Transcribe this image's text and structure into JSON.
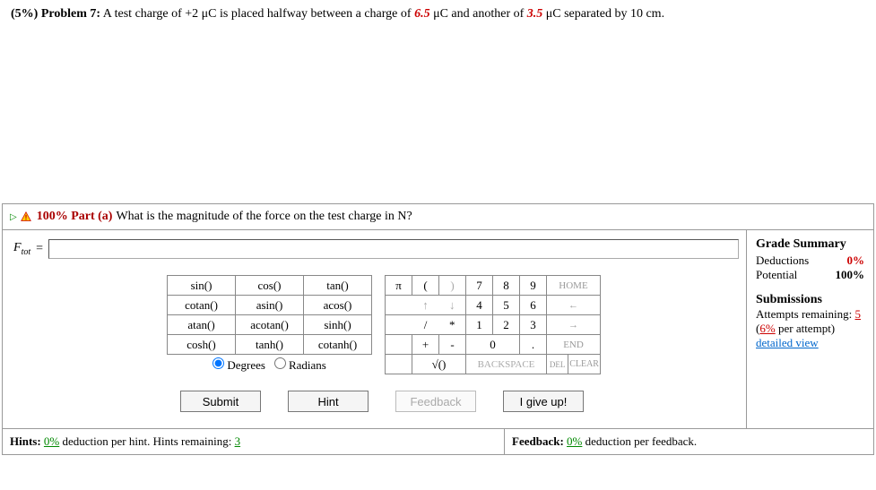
{
  "problem": {
    "label_prefix": "(5%) Problem 7:",
    "text_before_g1": " A test charge of +2 μC is placed halfway between a charge of ",
    "given1": "6.5",
    "text_mid": " μC and another of ",
    "given2": "3.5",
    "text_after": " μC separated by 10 cm."
  },
  "part": {
    "percent_label": "100% Part (a)",
    "question": "  What is the magnitude of the force on the test charge in N?"
  },
  "answer": {
    "var": "F",
    "sub": "tot",
    "equals": " = ",
    "value": ""
  },
  "funcs": {
    "r1": [
      "sin()",
      "cos()",
      "tan()"
    ],
    "r2": [
      "cotan()",
      "asin()",
      "acos()"
    ],
    "r3": [
      "atan()",
      "acotan()",
      "sinh()"
    ],
    "r4": [
      "cosh()",
      "tanh()",
      "cotanh()"
    ]
  },
  "angle": {
    "deg": "Degrees",
    "rad": "Radians"
  },
  "keys": {
    "pi": "π",
    "lp": "(",
    "rp": ")",
    "k7": "7",
    "k8": "8",
    "k9": "9",
    "home": "HOME",
    "up": "↑",
    "dn": "↓",
    "k4": "4",
    "k5": "5",
    "k6": "6",
    "left": "←",
    "div": "/",
    "mul": "*",
    "k1": "1",
    "k2": "2",
    "k3": "3",
    "right": "→",
    "plus": "+",
    "minus": "-",
    "k0": "0",
    "dot": ".",
    "end": "END",
    "sqrt": "√()",
    "bksp": "BACKSPACE",
    "del": "DEL",
    "clear": "CLEAR"
  },
  "buttons": {
    "submit": "Submit",
    "hint": "Hint",
    "feedback": "Feedback",
    "giveup": "I give up!"
  },
  "footer": {
    "hints_label": "Hints: ",
    "hints_pct": "0%",
    "hints_mid": " deduction per hint. Hints remaining: ",
    "hints_remain": "3",
    "fb_label": "Feedback: ",
    "fb_pct": "0%",
    "fb_tail": " deduction per feedback."
  },
  "grade": {
    "heading": "Grade Summary",
    "ded_label": "Deductions",
    "ded_val": "0%",
    "pot_label": "Potential",
    "pot_val": "100%",
    "sub_heading": "Submissions",
    "att_label": "Attempts remaining: ",
    "att_val": "5",
    "per_l": "(",
    "per_pct": "6%",
    "per_r": " per attempt)",
    "detailed": "detailed view"
  }
}
